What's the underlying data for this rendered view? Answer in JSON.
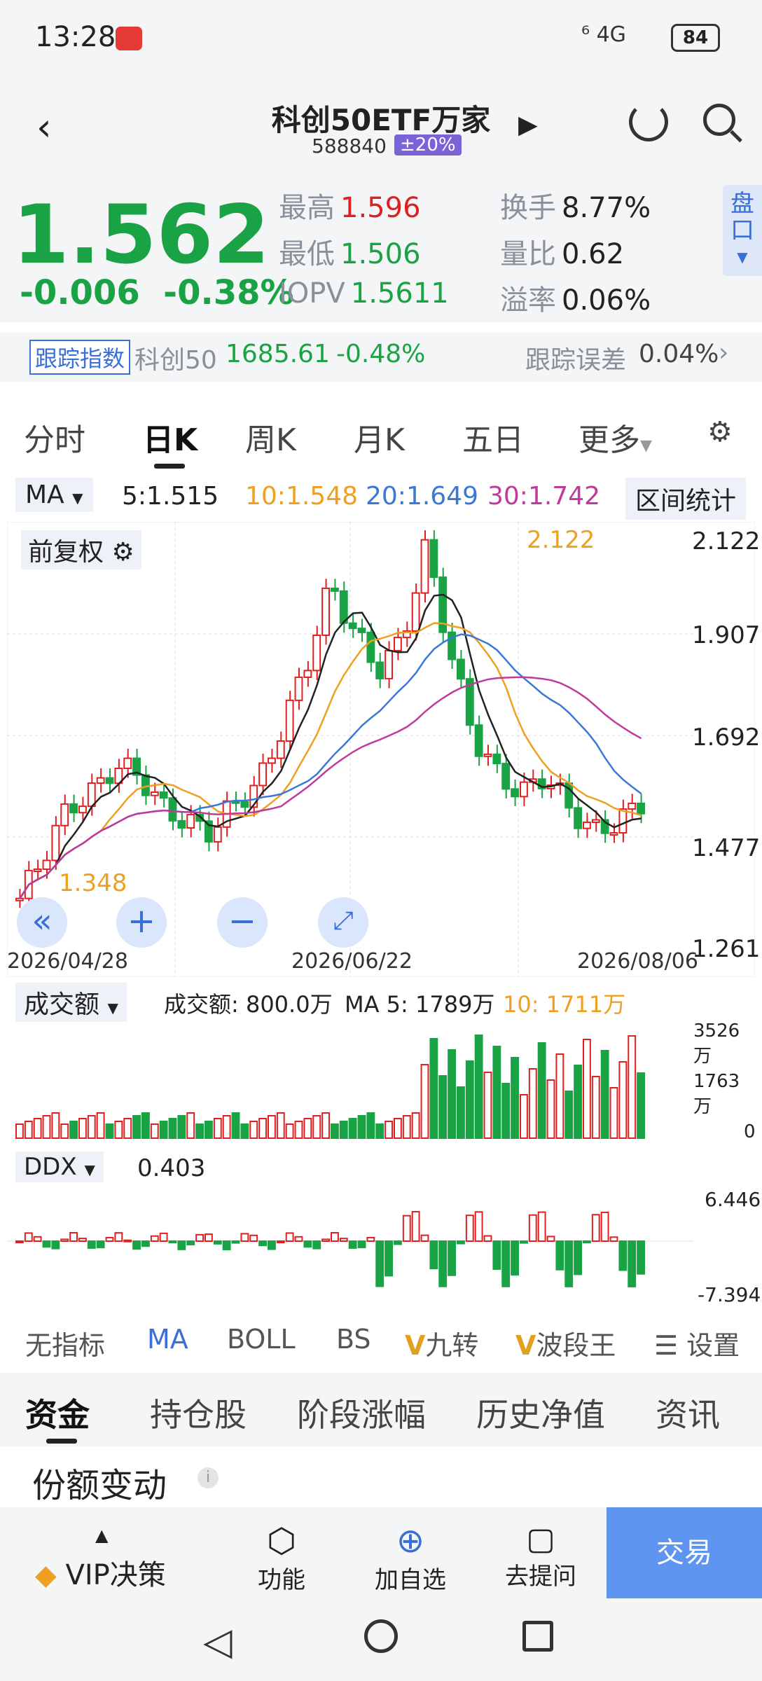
{
  "status": {
    "time": "13:28",
    "signal": "⁶ 4G",
    "battery": "84"
  },
  "header": {
    "title": "科创50ETF万家",
    "code": "588840",
    "limit_badge": "±20%"
  },
  "quote": {
    "price": "1.562",
    "change": "-0.006",
    "change_pct": "-0.38%",
    "high_label": "最高",
    "high": "1.596",
    "low_label": "最低",
    "low": "1.506",
    "iopv_label": "IOPV",
    "iopv": "1.5611",
    "turnover_label": "换手",
    "turnover": "8.77%",
    "vol_ratio_label": "量比",
    "vol_ratio": "0.62",
    "premium_label": "溢率",
    "premium": "0.06%",
    "pan_label": "盘口"
  },
  "track": {
    "tag": "跟踪指数",
    "index_name": "科创50",
    "index_value": "1685.61",
    "index_change": "-0.48%",
    "error_label": "跟踪误差",
    "error_value": "0.04%"
  },
  "ktabs": [
    "分时",
    "日K",
    "周K",
    "月K",
    "五日",
    "更多"
  ],
  "ma_row": {
    "selector": "MA",
    "ma5": "5:1.515",
    "ma10": "10:1.548",
    "ma20": "20:1.649",
    "ma30": "30:1.742",
    "range_button": "区间统计"
  },
  "chart": {
    "adjust_label": "前复权",
    "y_ticks": [
      "2.122",
      "1.907",
      "1.692",
      "1.477",
      "1.261"
    ],
    "max_label": "2.122",
    "min_label": "1.348",
    "dates": [
      "2026/04/28",
      "2026/06/22",
      "2026/08/06"
    ]
  },
  "colors": {
    "up": "#e02020",
    "down": "#1aa345",
    "ma5": "#222222",
    "ma10": "#f0a020",
    "ma20": "#3a78d8",
    "ma30": "#c03a9a"
  },
  "volume": {
    "selector": "成交额",
    "value_label": "成交额: 800.0万",
    "ma5": "MA 5: 1789万",
    "ma10": "10: 1711万",
    "ticks": [
      "3526万",
      "1763万",
      "0"
    ]
  },
  "ddx": {
    "selector": "DDX",
    "value": "0.403",
    "ticks": [
      "6.446",
      "-7.394"
    ]
  },
  "indicators": [
    "无指标",
    "MA",
    "BOLL",
    "BS",
    "九转",
    "波段王",
    "设置"
  ],
  "fund_tabs": [
    "资金",
    "持仓股",
    "阶段涨幅",
    "历史净值",
    "资讯"
  ],
  "section_title": "份额变动",
  "bottom": {
    "vip": "VIP决策",
    "func": "功能",
    "add": "加自选",
    "ask": "去提问",
    "trade": "交易"
  }
}
